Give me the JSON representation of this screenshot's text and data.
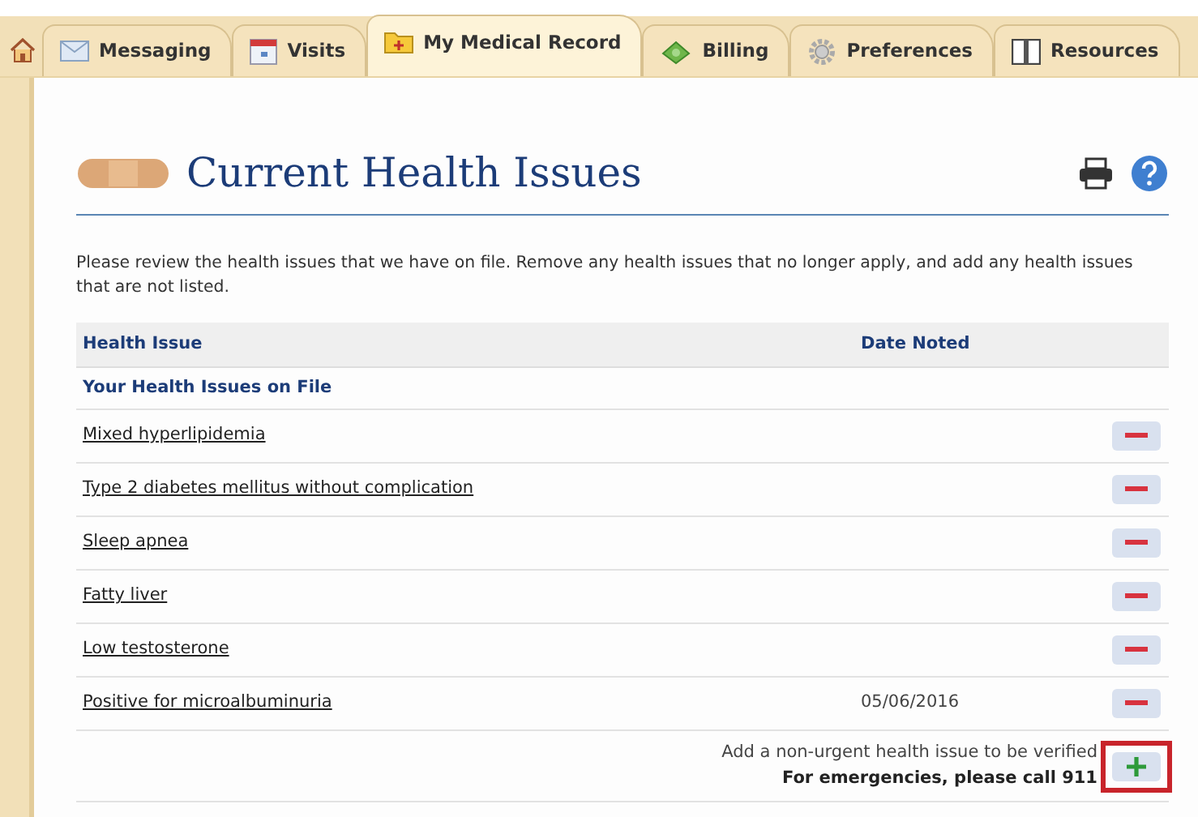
{
  "tabs": [
    {
      "label": "Messaging",
      "selected": false
    },
    {
      "label": "Visits",
      "selected": false
    },
    {
      "label": "My Medical Record",
      "selected": true
    },
    {
      "label": "Billing",
      "selected": false
    },
    {
      "label": "Preferences",
      "selected": false
    },
    {
      "label": "Resources",
      "selected": false
    }
  ],
  "page": {
    "title": "Current Health Issues",
    "intro": "Please review the health issues that we have on file. Remove any health issues that no longer apply, and add any health issues that are not listed."
  },
  "table": {
    "columns": [
      "Health Issue",
      "Date Noted"
    ],
    "section": "Your Health Issues on File",
    "rows": [
      {
        "issue": "Mixed hyperlipidemia"
      },
      {
        "issue": "Type 2 diabetes mellitus without complication"
      },
      {
        "issue": "Sleep apnea"
      },
      {
        "issue": "Fatty liver"
      },
      {
        "issue": "Low testosterone"
      },
      {
        "issue": "Positive for microalbuminuria",
        "date": "05/06/2016"
      }
    ]
  },
  "add": {
    "text": "Add a non-urgent health issue to be verified",
    "note": "For emergencies, please call 911",
    "highlighted": true
  }
}
